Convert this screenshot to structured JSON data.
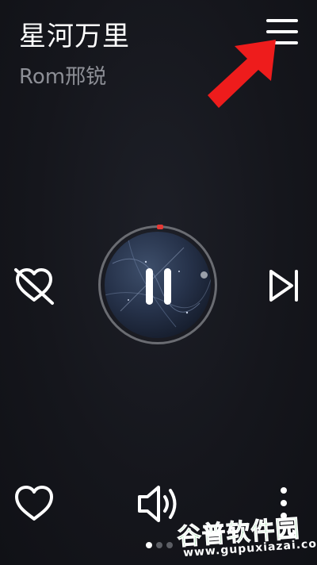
{
  "song": {
    "title": "星河万里",
    "artist": "Rom邢锐"
  },
  "header": {
    "menu_icon": "hamburger-menu-icon",
    "annotation": "red-arrow-pointing-to-menu"
  },
  "player": {
    "state": "playing",
    "control_icon": "pause-icon",
    "progress_marker_color": "#e53935",
    "disc_art": "album-cover-art"
  },
  "controls": {
    "dislike_icon": "heart-crossed-icon",
    "next_icon": "skip-next-icon",
    "like_icon": "heart-outline-icon",
    "volume_icon": "speaker-volume-icon",
    "more_icon": "more-vertical-icon"
  },
  "pager": {
    "count": 3,
    "active": 0
  },
  "watermark": {
    "brand": "谷普软件园",
    "url": "www.gupuxiazai.com"
  },
  "colors": {
    "background": "#15161c",
    "artist_text": "#8d8f96",
    "accent_red": "#e53935",
    "watermark_green": "#2fb24a"
  }
}
